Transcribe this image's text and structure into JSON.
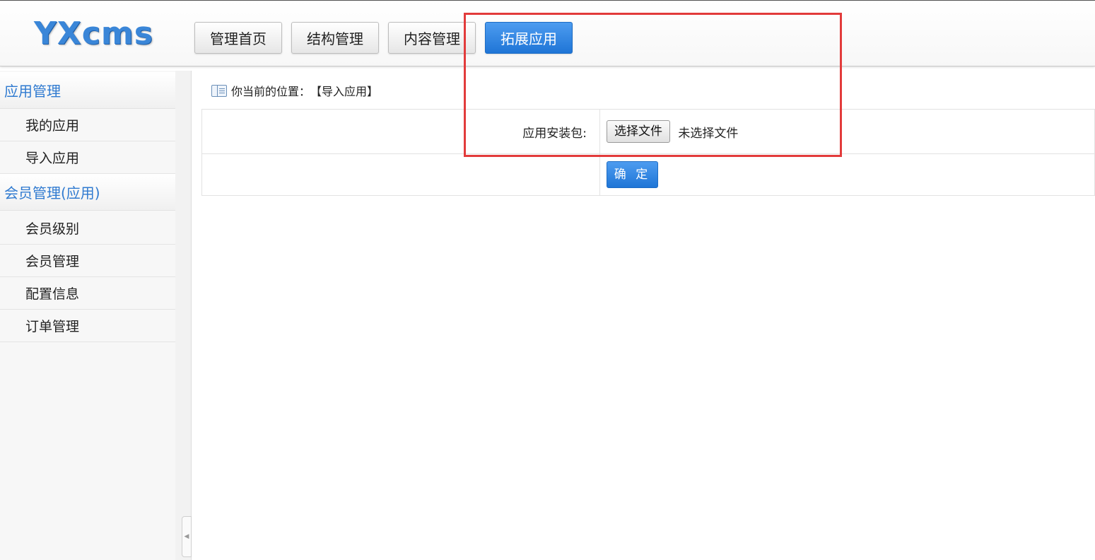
{
  "header": {
    "logo": "YXcms",
    "nav": [
      {
        "label": "管理首页"
      },
      {
        "label": "结构管理"
      },
      {
        "label": "内容管理"
      },
      {
        "label": "拓展应用",
        "active": true
      }
    ]
  },
  "sidebar": {
    "groups": [
      {
        "title": "应用管理",
        "items": [
          "我的应用",
          "导入应用"
        ]
      },
      {
        "title": "会员管理(应用)",
        "items": [
          "会员级别",
          "会员管理",
          "配置信息",
          "订单管理"
        ]
      }
    ]
  },
  "breadcrumb": {
    "prefix": "你当前的位置：",
    "current": "【导入应用】"
  },
  "form": {
    "package_label": "应用安装包:",
    "file_button": "选择文件",
    "file_status": "未选择文件",
    "submit_label": "确 定"
  },
  "colors": {
    "accent": "#2f7ad0",
    "active_button": "#1f75d6",
    "highlight": "#e23b3b"
  }
}
